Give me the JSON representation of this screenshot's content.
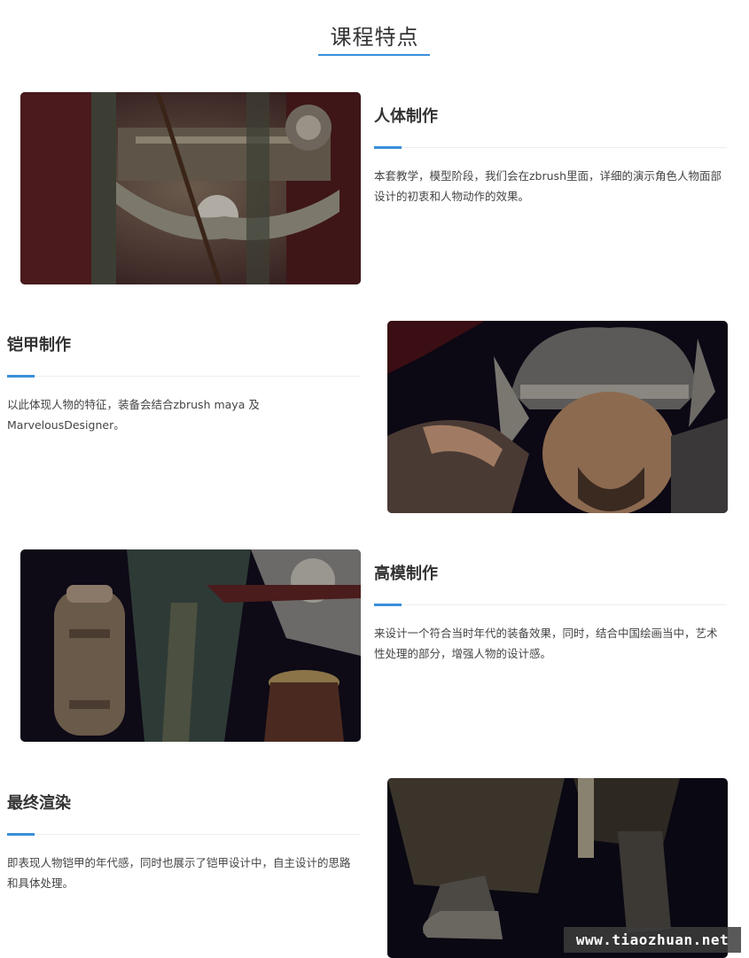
{
  "section": {
    "title": "课程特点"
  },
  "features": [
    {
      "heading": "人体制作",
      "description": "本套教学，模型阶段，我们会在zbrush里面，详细的演示角色人物面部设计的初衷和人物动作的效果。",
      "image": "armor-chest-closeup-photo"
    },
    {
      "heading": "铠甲制作",
      "description": "以此体现人物的特征，装备会结合zbrush maya 及MarvelousDesigner。",
      "image": "warrior-helmet-portrait-photo"
    },
    {
      "heading": "高模制作",
      "description": "来设计一个符合当时年代的装备效果，同时，结合中国绘画当中，艺术性处理的部分，增强人物的设计感。",
      "image": "armor-ornament-tassel-photo"
    },
    {
      "heading": "最终渲染",
      "description": "即表现人物铠甲的年代感，同时也展示了铠甲设计中，自主设计的思路和具体处理。",
      "image": "warrior-boots-photo"
    }
  ],
  "watermark": "www.tiaozhuan.net",
  "colors": {
    "accent": "#3a8fd9",
    "divider": "#eeeeee",
    "text": "#333333"
  }
}
